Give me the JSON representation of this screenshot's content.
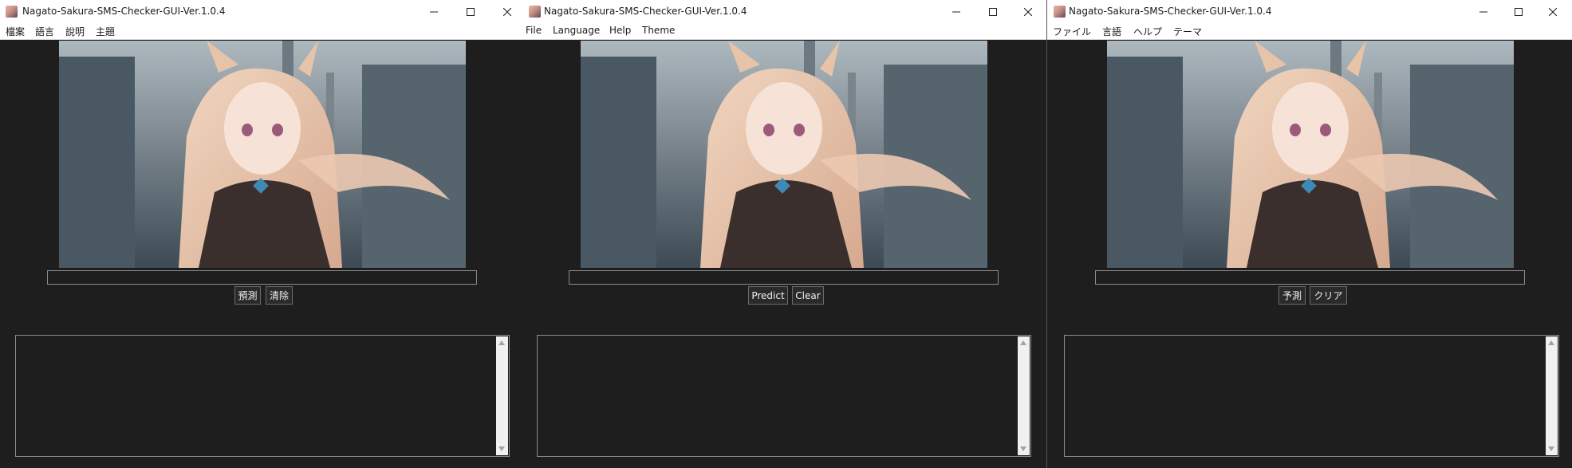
{
  "windows": [
    {
      "title": "Nagato-Sakura-SMS-Checker-GUI-Ver.1.0.4",
      "menu": [
        "檔案",
        "語言",
        "說明",
        "主題"
      ],
      "predict_label": "預測",
      "clear_label": "清除",
      "path_value": "",
      "result_text": ""
    },
    {
      "title": "Nagato-Sakura-SMS-Checker-GUI-Ver.1.0.4",
      "menu": [
        "File",
        "Language",
        "Help",
        "Theme"
      ],
      "predict_label": "Predict",
      "clear_label": "Clear",
      "path_value": "",
      "result_text": ""
    },
    {
      "title": "Nagato-Sakura-SMS-Checker-GUI-Ver.1.0.4",
      "menu": [
        "ファイル",
        "言語",
        "ヘルプ",
        "テーマ"
      ],
      "predict_label": "予測",
      "clear_label": "クリア",
      "path_value": "",
      "result_text": ""
    }
  ],
  "icons": {
    "app": "app-icon",
    "minimize": "minimize-icon",
    "maximize": "maximize-icon",
    "close": "close-icon",
    "scroll_up": "scroll-up-icon",
    "scroll_down": "scroll-down-icon"
  },
  "colors": {
    "background": "#1e1e1e",
    "titlebar": "#ffffff",
    "border": "#8c8c8c",
    "button_bg": "#2a2a2a",
    "button_text": "#f0f0f0"
  }
}
